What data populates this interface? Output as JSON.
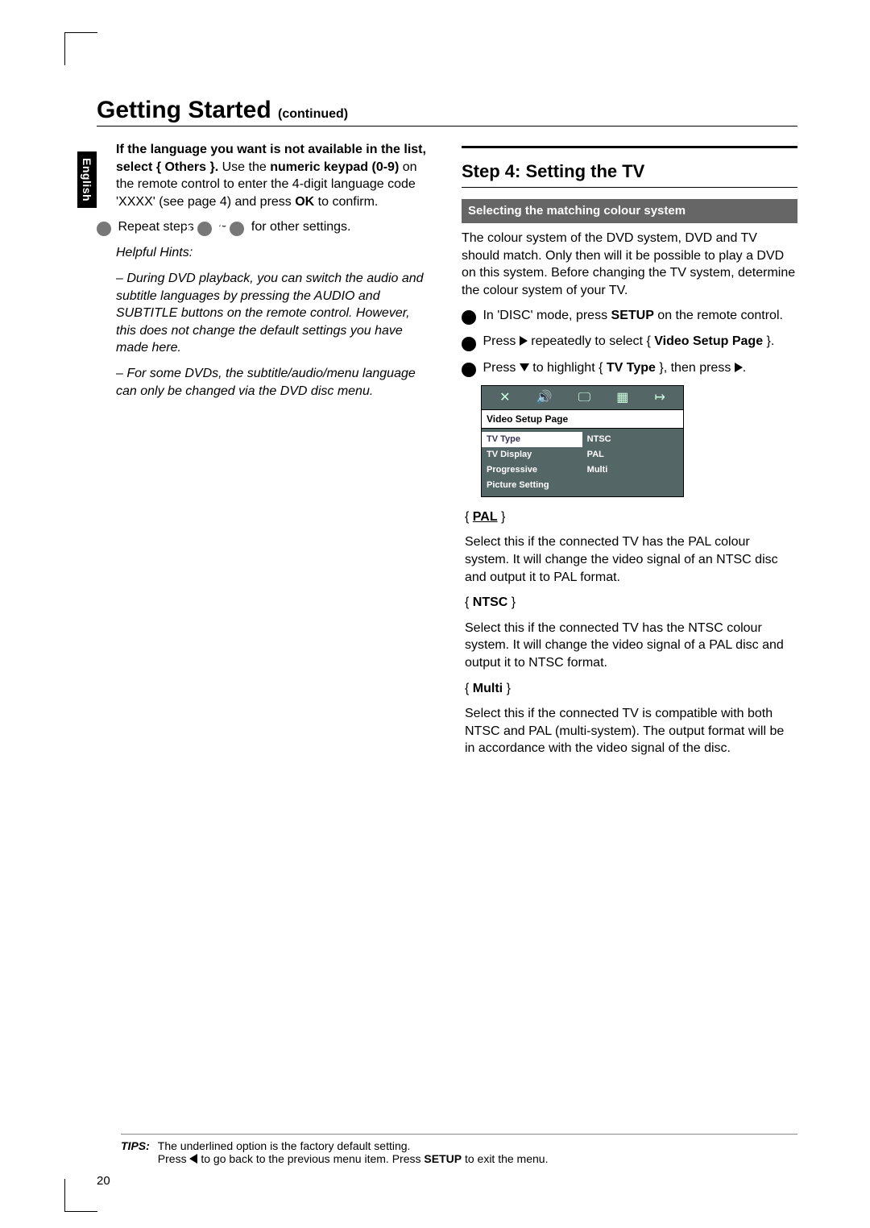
{
  "sideTab": "English",
  "title": "Getting Started",
  "titleSub": "(continued)",
  "left": {
    "p1_bold": "If the language you want is not available in the list, select { Others }.",
    "p1_rest_a": " Use the ",
    "p1_rest_b": "numeric keypad (0-9)",
    "p1_rest_c": " on the remote control to enter the 4-digit language code 'XXXX' (see page 4) and press ",
    "p1_rest_d": "OK",
    "p1_rest_e": " to confirm.",
    "step5_a": "Repeat steps ",
    "step5_b": " ~ ",
    "step5_c": " for other settings.",
    "hintsTitle": "Helpful Hints:",
    "hint1": "– During DVD playback, you can switch the audio and subtitle languages by pressing the AUDIO and SUBTITLE buttons on the remote control.  However, this does not change the default settings you have made here.",
    "hint2": "– For some DVDs, the subtitle/audio/menu language can only be changed via the DVD disc menu."
  },
  "right": {
    "stepTitle": "Step 4:  Setting the TV",
    "bandTitle": "Selecting the matching colour system",
    "intro": "The colour system of the DVD system, DVD and TV should match. Only then will it be possible to play a DVD on this system.  Before changing the TV system, determine the colour system of your TV.",
    "s1_a": "In 'DISC' mode, press ",
    "s1_b": "SETUP",
    "s1_c": " on the remote control.",
    "s2_a": "Press ",
    "s2_b": " repeatedly to select { ",
    "s2_c": "Video Setup Page",
    "s2_d": " }.",
    "s3_a": "Press ",
    "s3_b": " to highlight { ",
    "s3_c": "TV Type",
    "s3_d": " }, then press ",
    "s3_e": ".",
    "osd": {
      "band": "Video Setup Page",
      "left": [
        "TV Type",
        "TV Display",
        "Progressive",
        "Picture Setting"
      ],
      "right": [
        "NTSC",
        "PAL",
        "Multi"
      ]
    },
    "opt_pal_t": "PAL",
    "opt_pal_b": "Select this if the connected TV has the PAL colour system. It will change the video signal of an NTSC disc and output it to PAL format.",
    "opt_ntsc_t": "NTSC",
    "opt_ntsc_b": "Select this if the connected TV has the NTSC colour system. It will change the video signal of a PAL disc and output it to NTSC format.",
    "opt_multi_t": "Multi",
    "opt_multi_b": "Select this if the connected TV is compatible with both NTSC and PAL (multi-system).  The output format will be in accordance with the video signal of the disc."
  },
  "tips": {
    "label": "TIPS:",
    "line1": "The underlined option is the factory default setting.",
    "line2a": "Press ",
    "line2b": " to go back to the previous menu item.  Press ",
    "line2c": "SETUP",
    "line2d": " to exit the menu."
  },
  "pageNum": "20"
}
